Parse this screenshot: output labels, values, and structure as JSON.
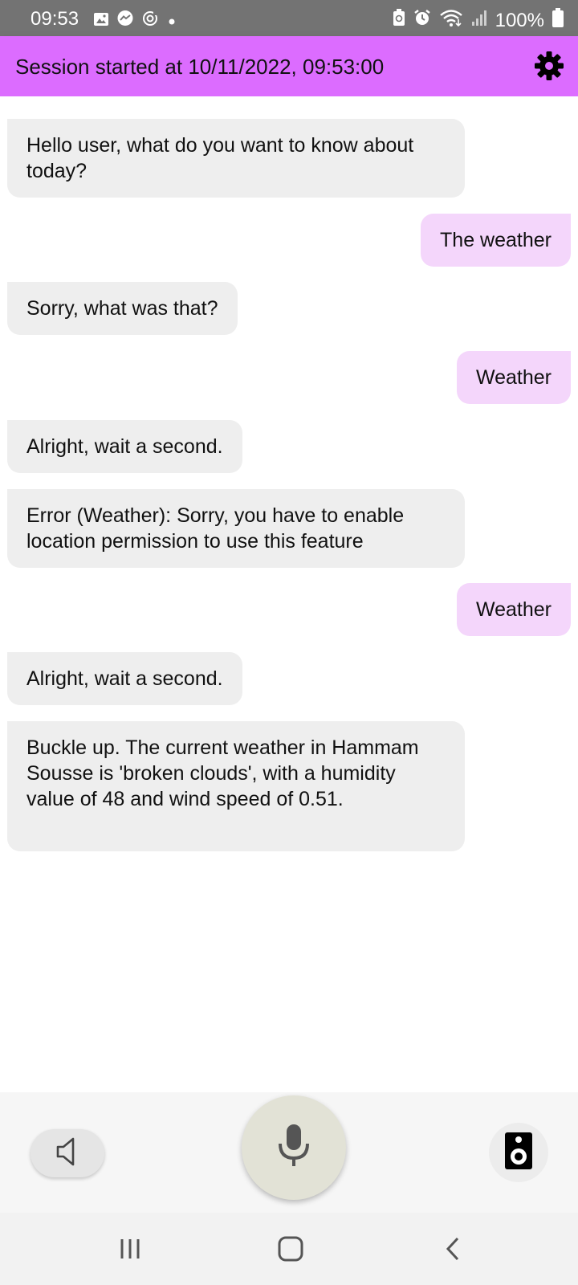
{
  "status_bar": {
    "time": "09:53",
    "battery": "100%",
    "left_icons": [
      "gallery-icon",
      "messenger-icon",
      "sync-icon",
      "dot-icon"
    ],
    "right_icons": [
      "battery-saver-icon",
      "alarm-icon",
      "wifi-icon",
      "signal-icon",
      "battery-icon"
    ]
  },
  "app_bar": {
    "title": "Session started at 10/11/2022, 09:53:00",
    "settings_icon": "gear-icon",
    "color": "#dc6cff"
  },
  "messages": [
    {
      "sender": "bot",
      "text": "Hello user, what do you want to know about today?"
    },
    {
      "sender": "user",
      "text": "The weather"
    },
    {
      "sender": "bot",
      "text": "Sorry, what was that?"
    },
    {
      "sender": "user",
      "text": "Weather"
    },
    {
      "sender": "bot",
      "text": "Alright, wait a second."
    },
    {
      "sender": "bot",
      "text": "Error (Weather): Sorry, you have to enable location permission to use this feature"
    },
    {
      "sender": "user",
      "text": "Weather"
    },
    {
      "sender": "bot",
      "text": "Alright, wait a second."
    },
    {
      "sender": "bot",
      "text": "Buckle up. The current weather in Hammam Sousse is 'broken clouds', with a humidity value of 48 and wind speed of 0.51."
    }
  ],
  "controls": {
    "left_icon": "volume-off-icon",
    "center_icon": "microphone-icon",
    "right_icon": "speaker-icon"
  },
  "nav_bar": {
    "icons": [
      "recent-apps-icon",
      "home-icon",
      "back-icon"
    ]
  },
  "colors": {
    "bot_bubble": "#eeeeee",
    "user_bubble": "#f4d6fb",
    "mic_button": "#e2e2d6"
  }
}
